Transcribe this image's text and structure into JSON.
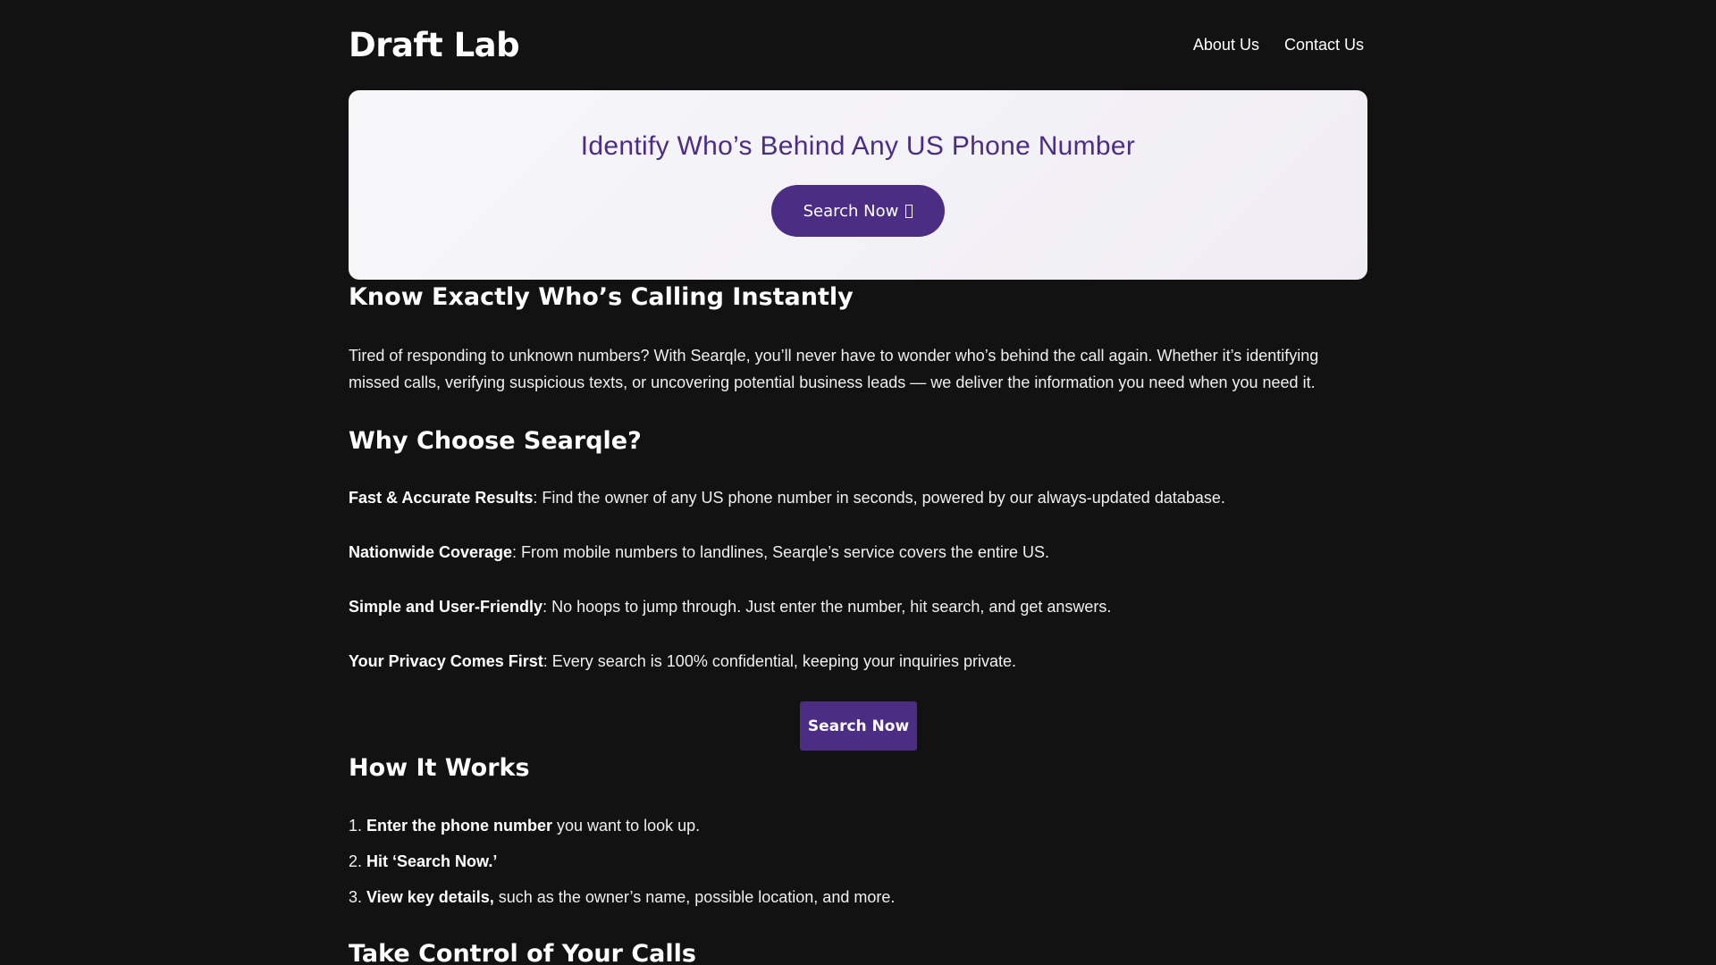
{
  "header": {
    "logo": "Draft Lab",
    "nav": [
      "About Us",
      "Contact Us"
    ]
  },
  "hero": {
    "title": "Identify Who’s Behind Any US Phone Number",
    "button_label": "Search Now"
  },
  "intro": {
    "title": "Know Exactly Who’s Calling Instantly",
    "text": "Tired of responding to unknown numbers? With Searqle, you’ll never have to wonder who’s behind the call again. Whether it’s identifying missed calls, verifying suspicious texts, or uncovering potential business leads — we deliver the information you need when you need it."
  },
  "why": {
    "title": "Why Choose Searqle?",
    "items": [
      {
        "bold": "Fast & Accurate Results",
        "text": ": Find the owner of any US phone number in seconds, powered by our always-updated database."
      },
      {
        "bold": "Nationwide Coverage",
        "text": ": From mobile numbers to landlines, Searqle’s service covers the entire US."
      },
      {
        "bold": "Simple and User-Friendly",
        "text": ": No hoops to jump through. Just enter the number, hit search, and get answers."
      },
      {
        "bold": "Your Privacy Comes First",
        "text": ": Every search is 100% confidential, keeping your inquiries private."
      }
    ],
    "cta_label": "Search Now"
  },
  "how": {
    "title": "How It Works",
    "steps": [
      {
        "bold": "Enter the phone number",
        "text": " you want to look up."
      },
      {
        "bold": "Hit ‘Search Now.’",
        "text": ""
      },
      {
        "bold": "View key details,",
        "text": " such as the owner’s name, possible location, and more."
      }
    ]
  },
  "control": {
    "title": "Take Control of Your Calls"
  },
  "colors": {
    "accent": "#4b2d83",
    "background": "#121213"
  },
  "icons": {
    "hero_button_glyph": "missing-glyph-icon"
  }
}
